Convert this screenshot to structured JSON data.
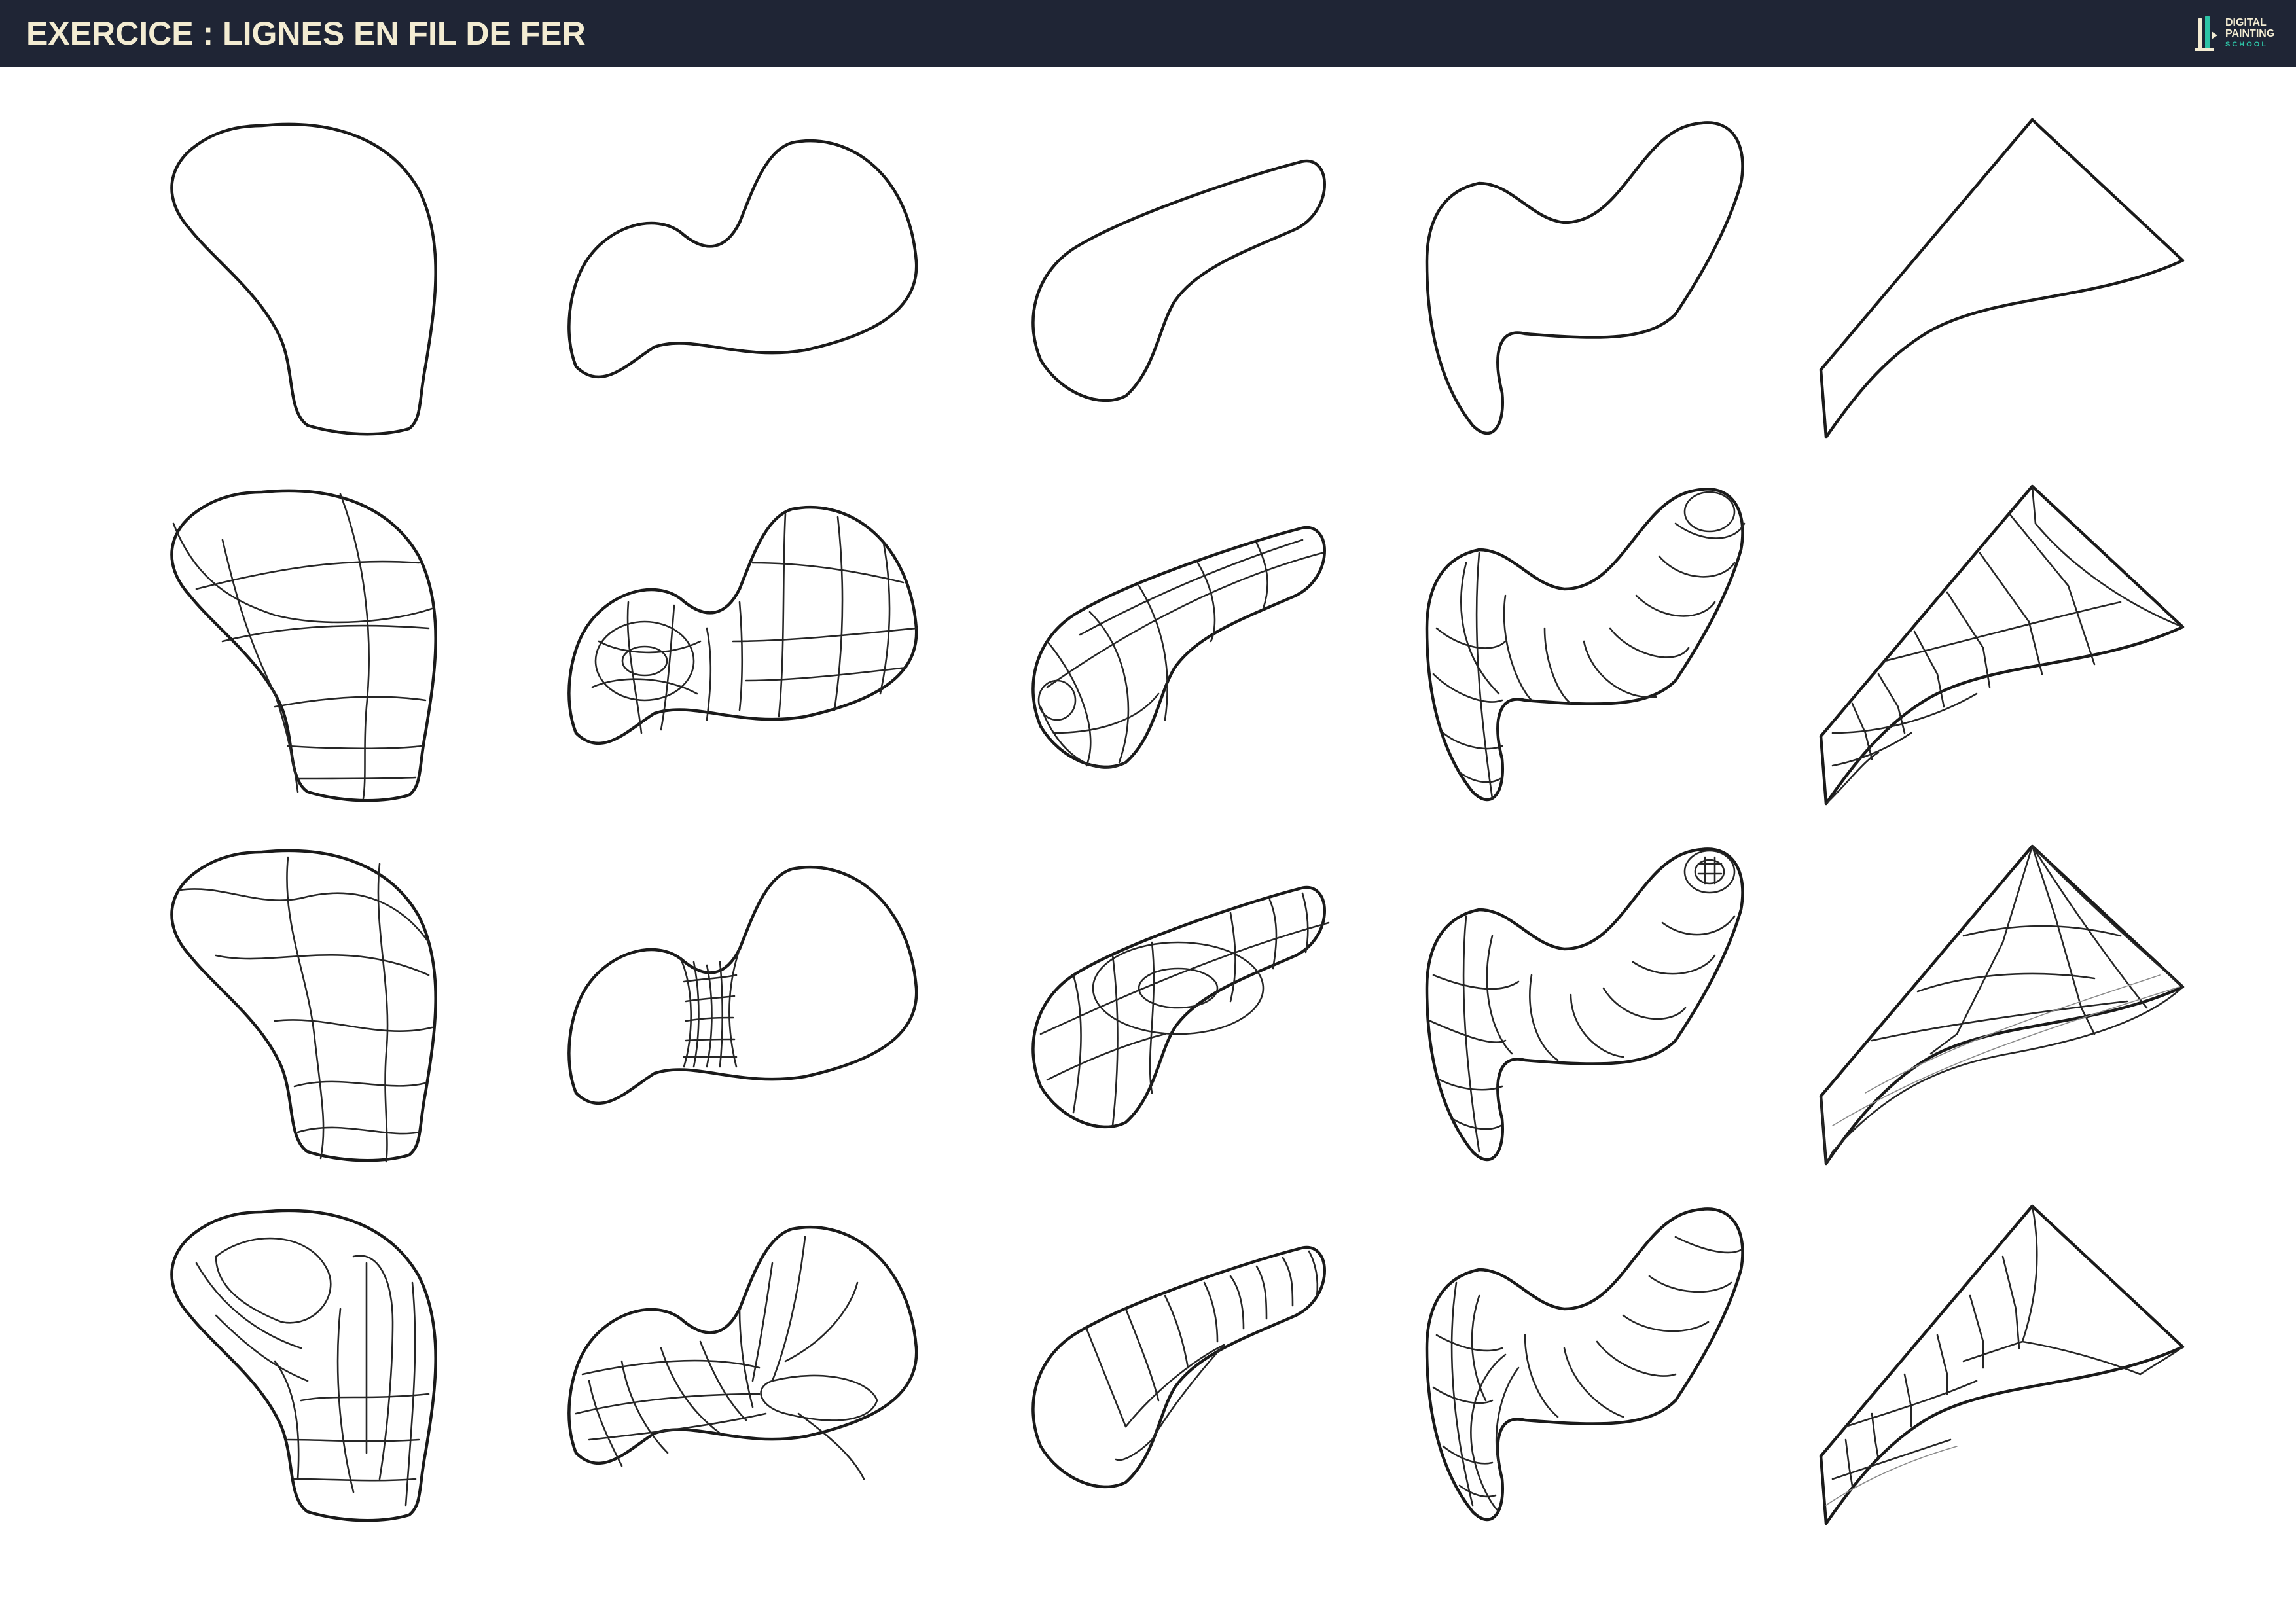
{
  "header": {
    "title": "EXERCICE : LIGNES EN FIL DE FER",
    "logo": {
      "line1": "DIGITAL",
      "line2": "PAINTING",
      "line3": "SCHOOL",
      "icon": "brush-logo-icon"
    }
  },
  "colors": {
    "header_bg": "#1f2535",
    "title_text": "#f3ecd2",
    "logo_accent": "#2ec4a6",
    "stroke": "#1a1a1a"
  },
  "grid": {
    "rows": 4,
    "columns": 5
  }
}
